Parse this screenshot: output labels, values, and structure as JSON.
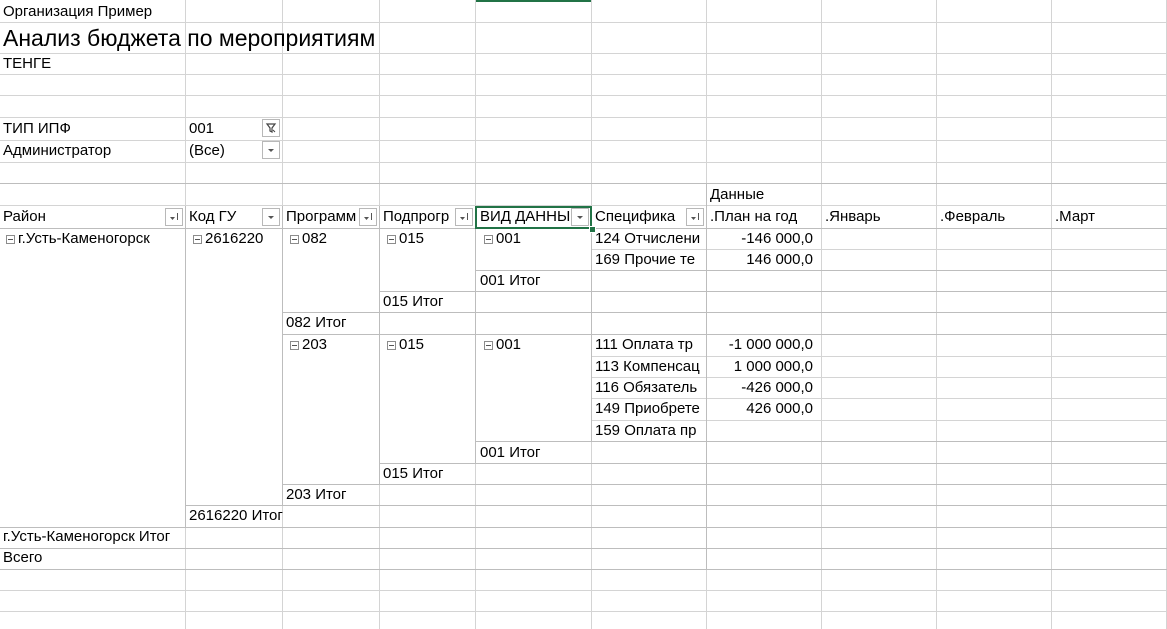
{
  "header": {
    "organization": "Организация Пример",
    "title": "Анализ бюджета по мероприятиям",
    "currency": "ТЕНГЕ"
  },
  "filters": [
    {
      "label": "ТИП ИПФ",
      "value": "001",
      "icon": "filter-applied-icon"
    },
    {
      "label": "Администратор",
      "value": "(Все)",
      "icon": "chevron-down-icon"
    }
  ],
  "pivot": {
    "data_caption": "Данные",
    "columns": {
      "rayon": "Район",
      "kod_gu": "Код ГУ",
      "programma": "Программ",
      "podprogramma": "Подпрогр",
      "vid_dannyh": "ВИД ДАННЫ",
      "specifika": "Специфика",
      "plan": ".План на год",
      "jan": ".Январь",
      "feb": ".Февраль",
      "mar": ".Март"
    },
    "rayon": "г.Усть-Каменогорск",
    "kod_gu": "2616220",
    "programs": [
      {
        "code": "082",
        "subprogram": "015",
        "data_type": "001",
        "items": [
          {
            "spec": "124 Отчислени",
            "plan": "-146 000,0"
          },
          {
            "spec": "169 Прочие те",
            "plan": "146 000,0"
          }
        ],
        "data_type_total": "001 Итог",
        "subprogram_total": "015 Итог",
        "program_total": "082 Итог"
      },
      {
        "code": "203",
        "subprogram": "015",
        "data_type": "001",
        "items": [
          {
            "spec": "111 Оплата тр",
            "plan": "-1 000 000,0"
          },
          {
            "spec": "113 Компенсац",
            "plan": "1 000 000,0"
          },
          {
            "spec": "116 Обязатель",
            "plan": "-426 000,0"
          },
          {
            "spec": "149 Приобрете",
            "plan": "426 000,0"
          },
          {
            "spec": "159 Оплата пр",
            "plan": ""
          }
        ],
        "data_type_total": "001 Итог",
        "subprogram_total": "015 Итог",
        "program_total": "203 Итог"
      }
    ],
    "kod_gu_total": "2616220 Итог",
    "rayon_total": "г.Усть-Каменогорск Итог",
    "grand_total": "Всего"
  }
}
